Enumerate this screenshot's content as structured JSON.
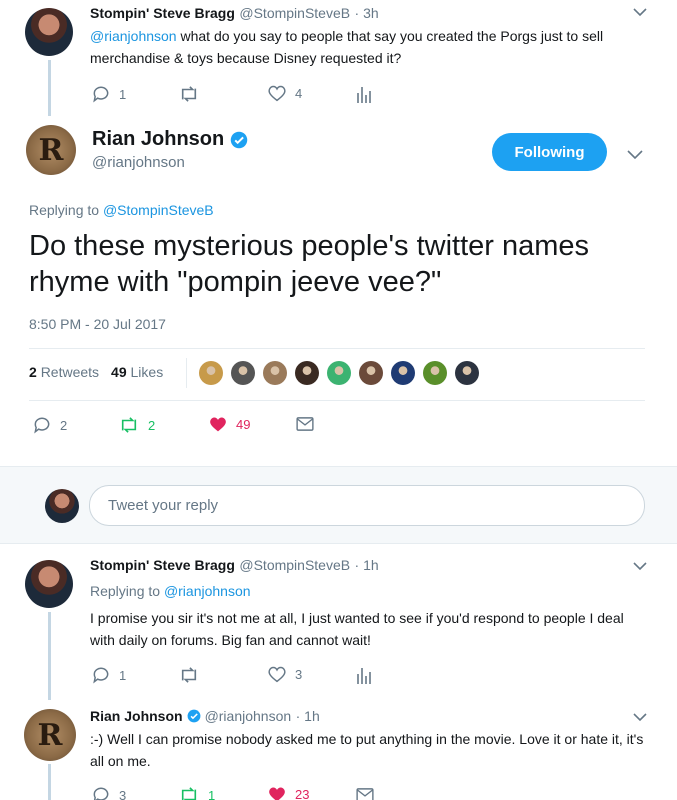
{
  "tweet1": {
    "name": "Stompin' Steve Bragg",
    "handle": "@StompinSteveB",
    "time": "· 3h",
    "mention": "@rianjohnson",
    "text": " what do you say to people that say you created the Porgs just to sell merchandise & toys because Disney requested it?",
    "replies": "1",
    "likes": "4"
  },
  "main_tweet": {
    "name": "Rian Johnson",
    "handle": "@rianjohnson",
    "avatar_letter": "R",
    "follow_label": "Following",
    "replying_prefix": "Replying to ",
    "replying_to": "@StompinSteveB",
    "text": "Do these mysterious people's twitter names rhyme with \"pompin jeeve vee?\"",
    "timestamp": "8:50 PM - 20 Jul 2017",
    "retweets_count": "2",
    "retweets_label": "Retweets",
    "likes_count": "49",
    "likes_label": "Likes",
    "action_replies": "2",
    "action_retweets": "2",
    "action_likes": "49",
    "liker_avatar_colors": [
      "#c79a4a",
      "#555555",
      "#9a7a5a",
      "#3a2a22",
      "#3cb371",
      "#6b4a3a",
      "#1f3b73",
      "#5a8f2a",
      "#2c3340"
    ]
  },
  "reply_box": {
    "placeholder": "Tweet your reply"
  },
  "tweet2": {
    "name": "Stompin' Steve Bragg",
    "handle": "@StompinSteveB",
    "time": "· 1h",
    "replying_prefix": "Replying to ",
    "replying_to": "@rianjohnson",
    "text": "I promise you sir it's not me at all, I just wanted to see if you'd respond to people I deal with daily on forums. Big fan and cannot wait!",
    "replies": "1",
    "likes": "3"
  },
  "tweet3": {
    "name": "Rian Johnson",
    "handle": "@rianjohnson",
    "time": "· 1h",
    "avatar_letter": "R",
    "text": ":-) Well I can promise nobody asked me to put anything in the movie. Love it or hate it, it's all on me.",
    "replies": "3",
    "retweets": "1",
    "likes": "23"
  },
  "colors": {
    "accent": "#1da1f2",
    "link": "#1b95e0",
    "like": "#e0245e",
    "retweet": "#17bf63",
    "muted": "#657786",
    "verified": "#1da1f2"
  }
}
